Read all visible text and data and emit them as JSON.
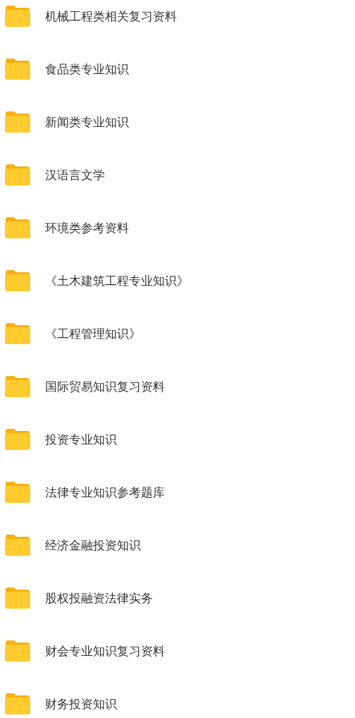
{
  "folders": [
    {
      "name": "机械工程类相关复习资料"
    },
    {
      "name": "食品类专业知识"
    },
    {
      "name": "新闻类专业知识"
    },
    {
      "name": "汉语言文学"
    },
    {
      "name": "环境类参考资料"
    },
    {
      "name": "《土木建筑工程专业知识》"
    },
    {
      "name": "《工程管理知识》"
    },
    {
      "name": "国际贸易知识复习资料"
    },
    {
      "name": "投资专业知识"
    },
    {
      "name": "法律专业知识参考题库"
    },
    {
      "name": "经济金融投资知识"
    },
    {
      "name": "股权投融资法律实务"
    },
    {
      "name": "财会专业知识复习资料"
    },
    {
      "name": "财务投资知识"
    }
  ]
}
